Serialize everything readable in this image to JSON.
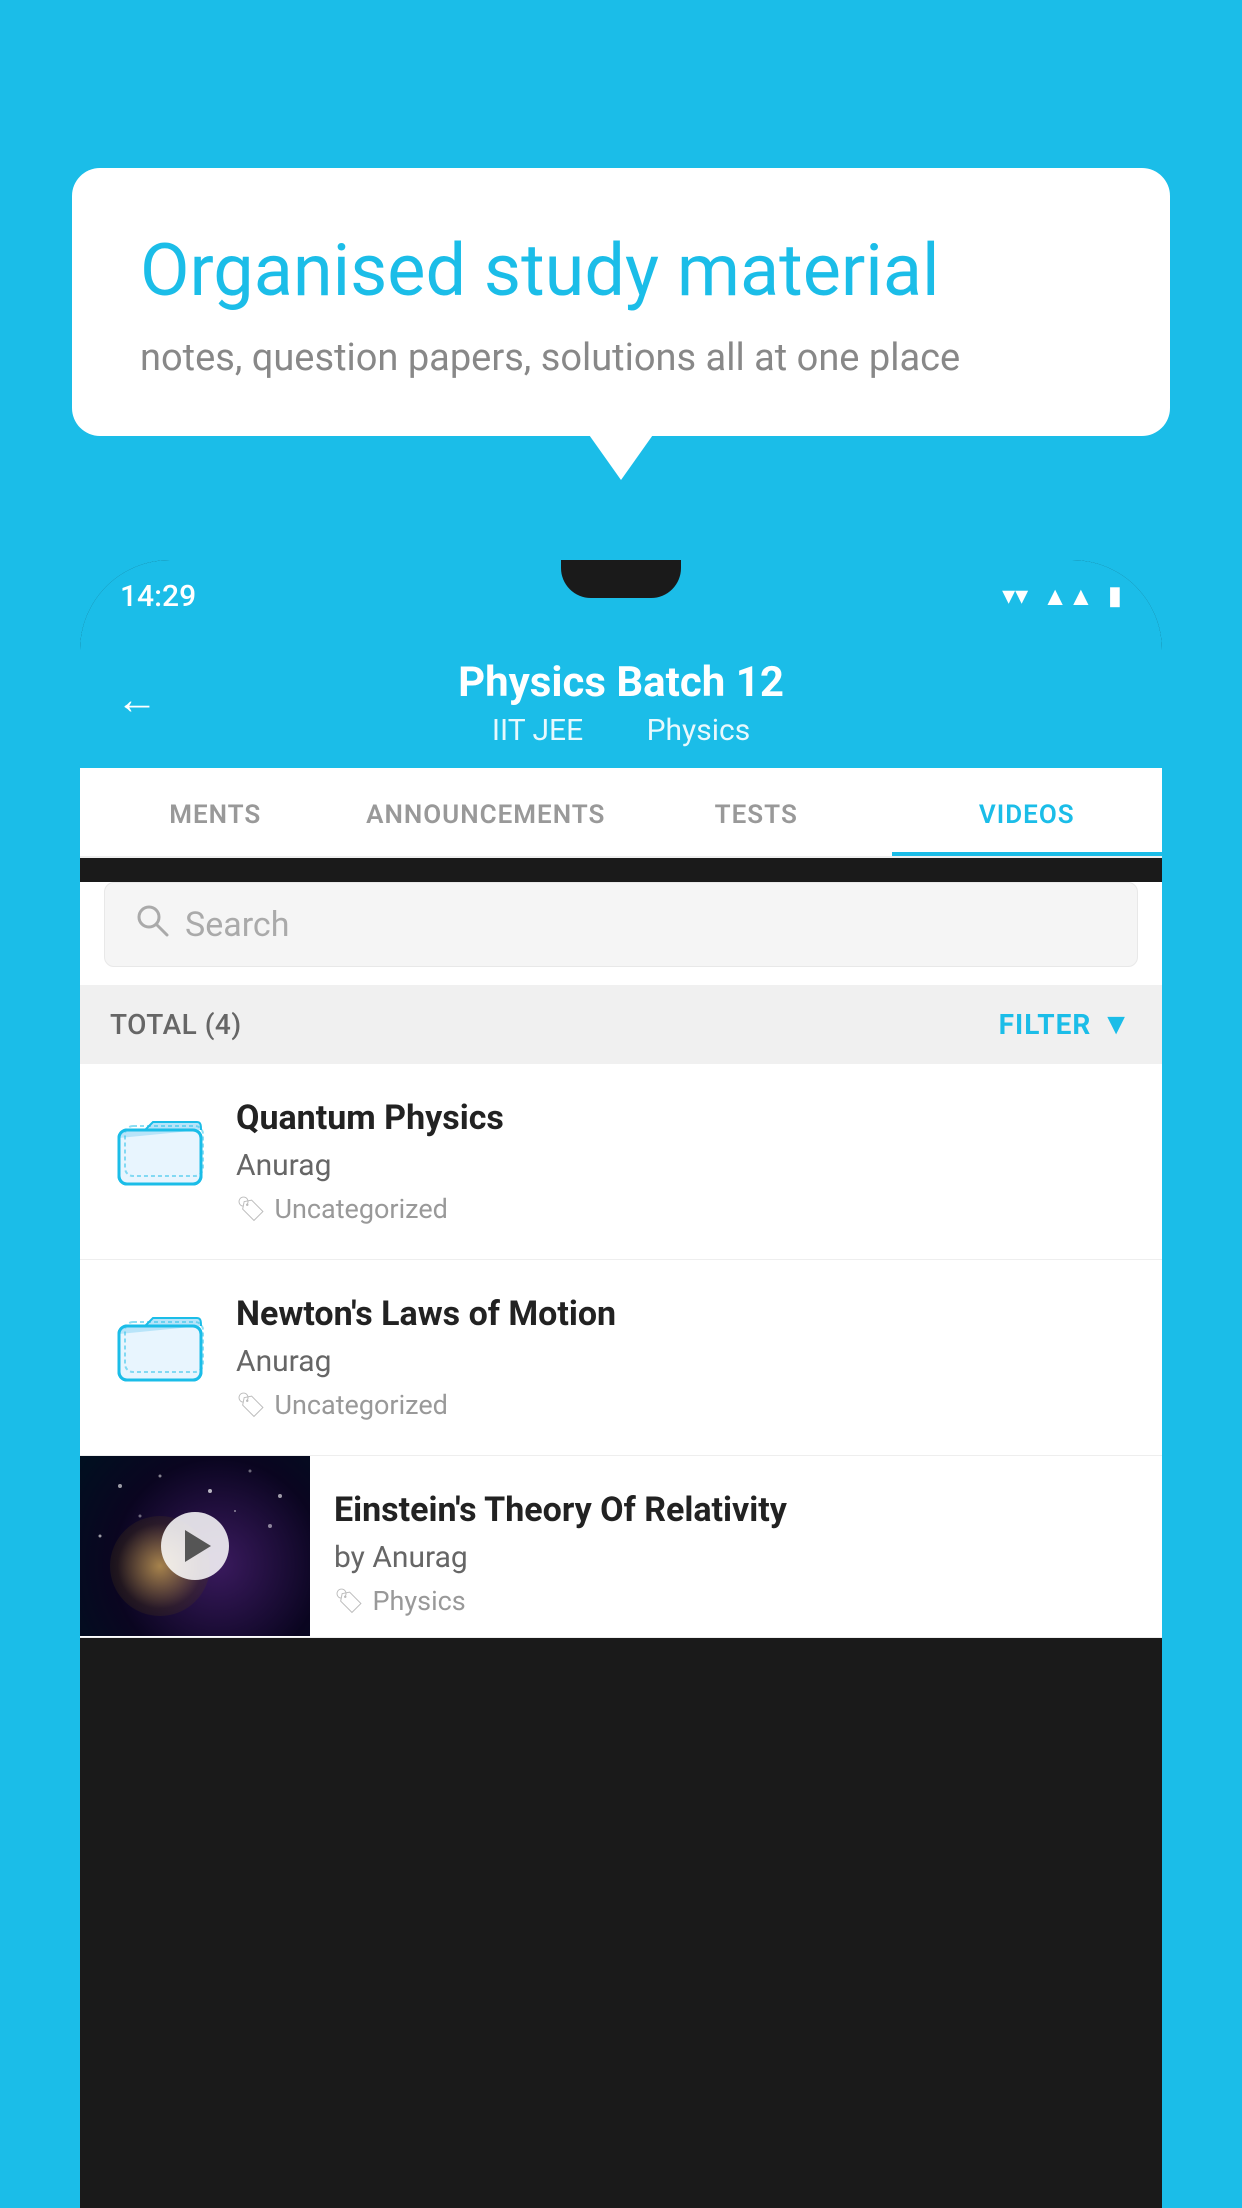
{
  "background_color": "#1bbde8",
  "speech_bubble": {
    "title": "Organised study material",
    "subtitle": "notes, question papers, solutions all at one place"
  },
  "phone": {
    "status_bar": {
      "time": "14:29"
    },
    "header": {
      "back_label": "←",
      "title": "Physics Batch 12",
      "subtitle_part1": "IIT JEE",
      "subtitle_part2": "Physics"
    },
    "tabs": [
      {
        "label": "MENTS",
        "active": false
      },
      {
        "label": "ANNOUNCEMENTS",
        "active": false
      },
      {
        "label": "TESTS",
        "active": false
      },
      {
        "label": "VIDEOS",
        "active": true
      }
    ],
    "search": {
      "placeholder": "Search"
    },
    "filter_row": {
      "total_label": "TOTAL (4)",
      "filter_label": "FILTER"
    },
    "videos": [
      {
        "id": "quantum",
        "title": "Quantum Physics",
        "author": "Anurag",
        "tag": "Uncategorized",
        "type": "folder"
      },
      {
        "id": "newton",
        "title": "Newton's Laws of Motion",
        "author": "Anurag",
        "tag": "Uncategorized",
        "type": "folder"
      },
      {
        "id": "einstein",
        "title": "Einstein's Theory Of Relativity",
        "author": "by Anurag",
        "tag": "Physics",
        "type": "video"
      }
    ]
  }
}
